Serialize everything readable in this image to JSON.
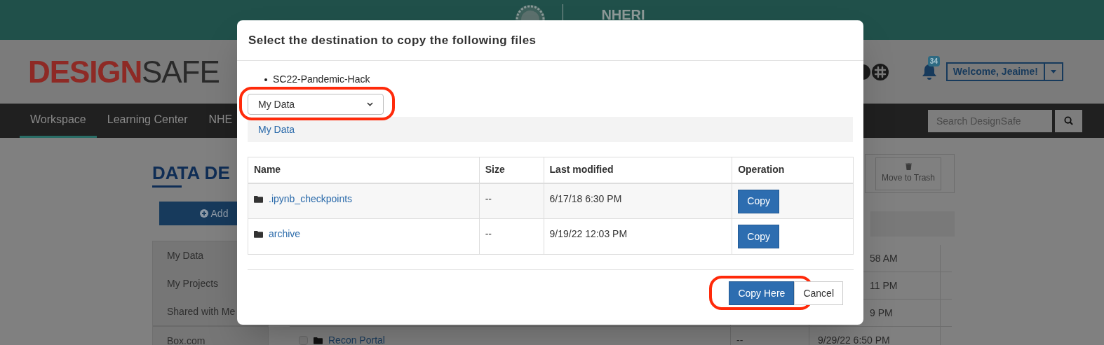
{
  "top_bar": {
    "org_label": "NHERI"
  },
  "header": {
    "logo": {
      "part_1": "DESIGN",
      "part_2": "SAFE"
    },
    "notifications": {
      "count": "34"
    },
    "user_button": {
      "label": "Welcome, Jeaime!"
    }
  },
  "nav": {
    "items": [
      {
        "label": "Workspace",
        "selected": true
      },
      {
        "label": "Learning Center",
        "selected": false
      },
      {
        "label": "NHE",
        "selected": false
      }
    ],
    "search": {
      "placeholder": "Search DesignSafe"
    }
  },
  "page": {
    "title": "DATA DE",
    "add_button": "Add",
    "sidebar": {
      "items": [
        {
          "label": "My Data"
        },
        {
          "label": "My Projects"
        },
        {
          "label": "Shared with Me"
        }
      ],
      "external": [
        {
          "label": "Box.com"
        }
      ]
    },
    "toolbar": {
      "trash_button": "Move to Trash"
    },
    "listing": {
      "rows": [
        {
          "modified": "58 AM"
        },
        {
          "modified": "11 PM"
        },
        {
          "modified": "9 PM"
        },
        {
          "name": "Recon Portal",
          "checked": false,
          "size": "--",
          "modified": "9/29/22 6:50 PM"
        }
      ]
    }
  },
  "dialog": {
    "title": "Select the destination to copy the following files",
    "files": [
      "SC22-Pandemic-Hack"
    ],
    "destination_select": {
      "value": "My Data",
      "highlighted": true
    },
    "breadcrumb": "My Data",
    "table": {
      "columns": [
        "Name",
        "Size",
        "Last modified",
        "Operation"
      ],
      "rows": [
        {
          "name": ".ipynb_checkpoints",
          "size": "--",
          "modified": "6/17/18 6:30 PM",
          "action": "Copy"
        },
        {
          "name": "archive",
          "size": "--",
          "modified": "9/19/22 12:03 PM",
          "action": "Copy"
        }
      ]
    },
    "buttons": [
      {
        "label": "Copy Here",
        "kind": "primary",
        "highlighted": true
      },
      {
        "label": "Cancel",
        "kind": "default",
        "highlighted": false
      }
    ]
  }
}
